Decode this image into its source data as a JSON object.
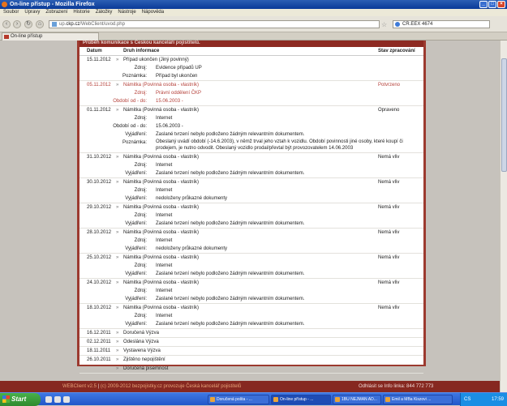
{
  "window": {
    "title": "On-line přístup - Mozilla Firefox"
  },
  "menu": [
    "Soubor",
    "Úpravy",
    "Zobrazení",
    "Historie",
    "Záložky",
    "Nástroje",
    "Nápověda"
  ],
  "url": {
    "prefix": "up.",
    "domain": "ckp.cz",
    "path": "/WebClient/uvod.php"
  },
  "search": {
    "value": "CR.EEX 4674"
  },
  "tab": {
    "label": "On-line přístup"
  },
  "panel": {
    "title": "Průběh komunikace s Českou kanceláří pojistitelů."
  },
  "columns": {
    "date": "Datum",
    "info": "Druh informace",
    "status": "Stav zpracování"
  },
  "records": [
    {
      "date": "15.11.2012",
      "arrow": "»",
      "title": "Případ ukončen (Jiný povinný)",
      "status": "",
      "red": false,
      "details": [
        {
          "k": "Zdroj:",
          "v": "Evidence případů UP"
        },
        {
          "k": "Poznámka:",
          "v": "Případ byl ukončen"
        }
      ]
    },
    {
      "date": "05.11.2012",
      "arrow": "»",
      "title": "Námitka (Povinná osoba - vlastník)",
      "status": "Potvrzeno",
      "red": true,
      "details": [
        {
          "k": "Zdroj:",
          "v": "Právní oddělení ČKP"
        },
        {
          "k": "Období od - do:",
          "v": "15.06.2003 -"
        }
      ]
    },
    {
      "date": "01.11.2012",
      "arrow": "»",
      "title": "Námitka (Povinná osoba - vlastník)",
      "status": "Opraveno",
      "red": false,
      "details": [
        {
          "k": "Zdroj:",
          "v": "Internet"
        },
        {
          "k": "Období od - do:",
          "v": "15.06.2003 -"
        },
        {
          "k": "Vyjádření:",
          "v": "Zaslané tvrzení nebylo podloženo žádným relevantním dokumentem."
        },
        {
          "k": "Poznámka:",
          "v": "Obeslaný uvádí období (-14.6.2003), v němž trval jeho vztah k vozidlu. Období povinnosti jiné osoby, které koupí či prodejem, je nutno odvodit. Obeslaný vozidlo prodal/převtal být provozovatelem 14.06.2003",
          "multi": true
        }
      ]
    },
    {
      "date": "31.10.2012",
      "arrow": "»",
      "title": "Námitka (Povinná osoba - vlastník)",
      "status": "Nemá vliv",
      "red": false,
      "details": [
        {
          "k": "Zdroj:",
          "v": "Internet"
        },
        {
          "k": "Vyjádření:",
          "v": "Zaslané tvrzení nebylo podloženo žádným relevantním dokumentem."
        }
      ]
    },
    {
      "date": "30.10.2012",
      "arrow": "»",
      "title": "Námitka (Povinná osoba - vlastník)",
      "status": "Nemá vliv",
      "red": false,
      "details": [
        {
          "k": "Zdroj:",
          "v": "Internet"
        },
        {
          "k": "Vyjádření:",
          "v": "nedoloženy průkazné dokumenty"
        }
      ]
    },
    {
      "date": "29.10.2012",
      "arrow": "»",
      "title": "Námitka (Povinná osoba - vlastník)",
      "status": "Nemá vliv",
      "red": false,
      "details": [
        {
          "k": "Zdroj:",
          "v": "Internet"
        },
        {
          "k": "Vyjádření:",
          "v": "Zaslané tvrzení nebylo podloženo žádným relevantním dokumentem."
        }
      ]
    },
    {
      "date": "28.10.2012",
      "arrow": "»",
      "title": "Námitka (Povinná osoba - vlastník)",
      "status": "Nemá vliv",
      "red": false,
      "details": [
        {
          "k": "Zdroj:",
          "v": "Internet"
        },
        {
          "k": "Vyjádření:",
          "v": "nedoloženy průkazné dokumenty"
        }
      ]
    },
    {
      "date": "25.10.2012",
      "arrow": "»",
      "title": "Námitka (Povinná osoba - vlastník)",
      "status": "Nemá vliv",
      "red": false,
      "details": [
        {
          "k": "Zdroj:",
          "v": "Internet"
        },
        {
          "k": "Vyjádření:",
          "v": "Zaslané tvrzení nebylo podloženo žádným relevantním dokumentem."
        }
      ]
    },
    {
      "date": "24.10.2012",
      "arrow": "»",
      "title": "Námitka (Povinná osoba - vlastník)",
      "status": "Nemá vliv",
      "red": false,
      "details": [
        {
          "k": "Zdroj:",
          "v": "Internet"
        },
        {
          "k": "Vyjádření:",
          "v": "Zaslané tvrzení nebylo podloženo žádným relevantním dokumentem."
        }
      ]
    },
    {
      "date": "18.10.2012",
      "arrow": "»",
      "title": "Námitka (Povinná osoba - vlastník)",
      "status": "Nemá vliv",
      "red": false,
      "details": [
        {
          "k": "Zdroj:",
          "v": "Internet"
        },
        {
          "k": "Vyjádření:",
          "v": "Zaslané tvrzení nebylo podloženo žádným relevantním dokumentem."
        }
      ]
    },
    {
      "date": "16.12.2011",
      "arrow": "»",
      "title": "Doručená Výzva",
      "status": "",
      "red": false,
      "details": []
    },
    {
      "date": "02.12.2011",
      "arrow": "»",
      "title": "Odeslána Výzva",
      "status": "",
      "red": false,
      "details": []
    },
    {
      "date": "18.11.2011",
      "arrow": "»",
      "title": "Vystavena Výzva",
      "status": "",
      "red": false,
      "details": []
    },
    {
      "date": "26.10.2011",
      "arrow": "»",
      "title": "Zjištěno nepojištění",
      "status": "",
      "red": false,
      "details": []
    },
    {
      "date": "",
      "arrow": "»",
      "title": "Doručená písemnost",
      "status": "",
      "red": false,
      "details": []
    }
  ],
  "footer": {
    "version": "WEBClient v2.5",
    "copyright": "(c) 2009-2012 bezpojistky.cz provozuje Česká kancelář pojistitelů",
    "links": "Odhlásit se   Info linka: 844 772 773"
  },
  "taskbar": {
    "start": "Start",
    "clock": "17:59",
    "buttons": [
      "Doručená pošta - ...",
      "On-line přístup - ...",
      "1BU NEJMAN AD...",
      "Emil a MBa Kiszovi ..."
    ],
    "tray_lang": "CS"
  }
}
